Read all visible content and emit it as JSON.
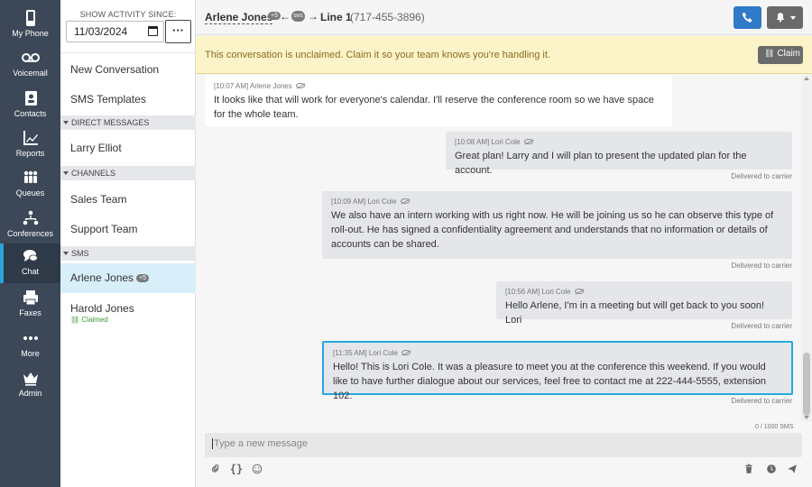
{
  "nav": [
    {
      "label": "My Phone",
      "icon": "phone-icon"
    },
    {
      "label": "Voicemail",
      "icon": "voicemail-icon"
    },
    {
      "label": "Contacts",
      "icon": "contacts-icon"
    },
    {
      "label": "Reports",
      "icon": "reports-icon"
    },
    {
      "label": "Queues",
      "icon": "queues-icon"
    },
    {
      "label": "Conferences",
      "icon": "conferences-icon"
    },
    {
      "label": "Chat",
      "icon": "chat-icon",
      "active": true
    },
    {
      "label": "Faxes",
      "icon": "fax-icon"
    },
    {
      "label": "More",
      "icon": "more-icon"
    },
    {
      "label": "Admin",
      "icon": "crown-icon"
    }
  ],
  "sidebar": {
    "since_label": "SHOW ACTIVITY SINCE:",
    "date_value": "11/03/2024",
    "more_label": "···",
    "new_conversation": "New Conversation",
    "sms_templates": "SMS Templates",
    "direct_header": "DIRECT MESSAGES",
    "direct_items": [
      "Larry Elliot"
    ],
    "channels_header": "CHANNELS",
    "channel_items": [
      "Sales Team",
      "Support Team"
    ],
    "sms_header": "SMS",
    "sms_items": [
      {
        "name": "Arlene Jones",
        "badge": "+5",
        "selected": true
      },
      {
        "name": "Harold Jones",
        "status": "Claimed"
      }
    ]
  },
  "header": {
    "contact_name": "Arlene Jones",
    "contact_badge": "+5",
    "arrow_in": "←",
    "sms_label": "SMS",
    "arrow_out": "→",
    "line_name": "Line 1",
    "line_number": "(717-455-3896)"
  },
  "banner": {
    "text": "This conversation is unclaimed. Claim it so your team knows you're handling it.",
    "claim_label": "Claim"
  },
  "messages": [
    {
      "time": "[10:07 AM]",
      "author": "Arlene Jones",
      "direction": "in",
      "text": "It looks like that will work for everyone's calendar. I'll reserve the conference room so we have space for the whole team.",
      "status": ""
    },
    {
      "time": "[10:08 AM]",
      "author": "Lori Cole",
      "direction": "out",
      "text": "Great plan! Larry and I will plan to present the updated plan for the account.",
      "status": "Delivered to carrier"
    },
    {
      "time": "[10:09 AM]",
      "author": "Lori Cole",
      "direction": "out",
      "text": "We also have an intern working with us right now. He will be joining us so he can observe this type of roll-out. He has signed a confidentiality agreement and understands that no information or details of accounts can be shared.",
      "status": "Delivered to carrier"
    },
    {
      "time": "[10:56 AM]",
      "author": "Lori Cole",
      "direction": "out",
      "text": "Hello Arlene, I'm in a meeting but will get back to you soon! Lori",
      "status": "Delivered to carrier"
    },
    {
      "time": "[11:35 AM]",
      "author": "Lori Cole",
      "direction": "out",
      "text": "Hello! This is Lori Cole. It was a pleasure to meet you at the conference this weekend. If you would like to have further dialogue about our services, feel free to contact me at 222-444-5555, extension 102.",
      "status": "Delivered to carrier",
      "highlighted": true
    }
  ],
  "composer": {
    "counter": "0 / 1000 SMS",
    "placeholder": "Type a new message"
  },
  "colors": {
    "rail": "#3c4858",
    "accent": "#26a9e0",
    "call_button": "#2f7ac9",
    "banner": "#fcf3c9",
    "claimed": "#3a9a3a"
  }
}
